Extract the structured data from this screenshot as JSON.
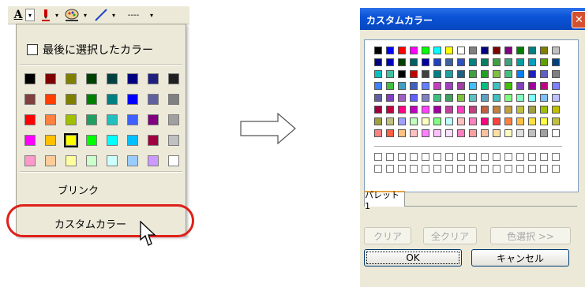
{
  "left_menu": {
    "toolbar": {
      "font_color_letter": "A",
      "line_style_label": "----"
    },
    "recent_colors_label": "最後に選択したカラー",
    "swatches": [
      "#000000",
      "#800000",
      "#808000",
      "#004000",
      "#004040",
      "#000080",
      "#1f1f80",
      "#202020",
      "#804040",
      "#ff4000",
      "#808000",
      "#008000",
      "#008080",
      "#0000ff",
      "#6060a0",
      "#808080",
      "#ff0000",
      "#ff8040",
      "#a0c000",
      "#20a060",
      "#20c0c0",
      "#4060ff",
      "#800080",
      "#a0a0a0",
      "#ff00ff",
      "#ffc000",
      "#ffff00",
      "#00ff00",
      "#00ffff",
      "#00c0ff",
      "#a00040",
      "#c0c0c0",
      "#ff99cc",
      "#ffcc99",
      "#ffffa0",
      "#ccffcc",
      "#ccffff",
      "#99ccff",
      "#cc99ff",
      "#ffffff"
    ],
    "blink_label": "ブリンク",
    "custom_color_label": "カスタムカラー"
  },
  "dialog": {
    "title": "カスタムカラー",
    "close_glyph": "✕",
    "palette_rows": [
      [
        "#000000",
        "#0000ff",
        "#ff0000",
        "#ff00ff",
        "#00ff00",
        "#00ffff",
        "#ffff00",
        "#ffffff",
        "#808080",
        "#000080",
        "#800000",
        "#800080",
        "#008000",
        "#008080",
        "#808000",
        "#c0c0c0"
      ],
      [
        "#000080",
        "#0000c0",
        "#004000",
        "#006060",
        "#0000a0",
        "#2040c0",
        "#4060a0",
        "#3050c0",
        "#008080",
        "#008060",
        "#40a040",
        "#40a080",
        "#00a0a0",
        "#00a0c0",
        "#60a000",
        "#004080"
      ],
      [
        "#00c0c0",
        "#40c0a0",
        "#000000",
        "#c00000",
        "#404040",
        "#008080",
        "#20a0a0",
        "#206080",
        "#40a040",
        "#20a020",
        "#80c040",
        "#40c080",
        "#0080ff",
        "#2020c0",
        "#6060c0",
        "#808080"
      ],
      [
        "#4080ff",
        "#40c040",
        "#40a0c0",
        "#4060c0",
        "#6080ff",
        "#c040c0",
        "#a040c0",
        "#a040a0",
        "#40c0ff",
        "#00c080",
        "#40c0c0",
        "#40c000",
        "#8040c0",
        "#a000a0",
        "#c00080",
        "#8080ff"
      ],
      [
        "#6060a0",
        "#8040c0",
        "#a060c0",
        "#6060ff",
        "#8080c0",
        "#40c080",
        "#40a060",
        "#80c040",
        "#60c0c0",
        "#60a0c0",
        "#40c0c0",
        "#80ff80",
        "#80ffc0",
        "#80ffff",
        "#80c0ff",
        "#c0c0ff"
      ],
      [
        "#a00040",
        "#c00040",
        "#ff0080",
        "#c000c0",
        "#ff40ff",
        "#a000a0",
        "#c040a0",
        "#ff40c0",
        "#c04080",
        "#c06040",
        "#c08040",
        "#c0a040",
        "#c0c040",
        "#a0a040",
        "#a0c000",
        "#c0c000"
      ],
      [
        "#a0a040",
        "#c0c080",
        "#a0a0ff",
        "#c0ffc0",
        "#ffffc0",
        "#80ff80",
        "#c0ffff",
        "#ffc0c0",
        "#ff80c0",
        "#ff0080",
        "#ff4040",
        "#ff8040",
        "#ffc040",
        "#ffe040",
        "#ffff40",
        "#c0c040"
      ],
      [
        "#ff8080",
        "#ff6040",
        "#ffc080",
        "#ffc0c0",
        "#ff80ff",
        "#ffc0ff",
        "#ffe0ff",
        "#ff80c0",
        "#ffa0a0",
        "#ffc0a0",
        "#ffe0a0",
        "#ffffc0",
        "#e0e0e0",
        "#c0c0c0",
        "#a0a0a0",
        "#ffffff"
      ]
    ],
    "empty_rows": 2,
    "empty_cols": 16,
    "tab_label": "パレット1",
    "buttons": {
      "clear": "クリア",
      "clear_all": "全クリア",
      "color_select": "色選択 >>",
      "ok": "OK",
      "cancel": "キャンセル"
    }
  }
}
